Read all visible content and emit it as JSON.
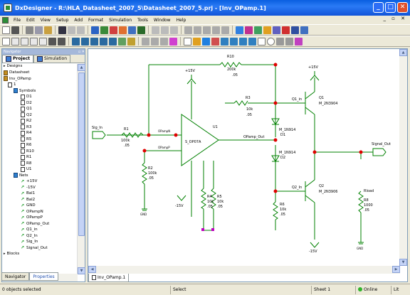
{
  "window": {
    "title": "DxDesigner - R:\\HLA_Datasheet_2007_5\\Datasheet_2007_5.prj - [Inv_OPamp.1]"
  },
  "menu": [
    "File",
    "Edit",
    "View",
    "Setup",
    "Add",
    "Format",
    "Simulation",
    "Tools",
    "Window",
    "Help"
  ],
  "panel": {
    "caption": "Navigator",
    "tabs": [
      "Project",
      "Simulation"
    ],
    "tree": [
      {
        "label": "Designs",
        "icon": "expand",
        "depth": 0
      },
      {
        "label": "Datasheet",
        "icon": "chip",
        "depth": 0
      },
      {
        "label": "Inv_OPamp",
        "icon": "chip",
        "depth": 1
      },
      {
        "label": "1",
        "icon": "sym",
        "depth": 2
      },
      {
        "label": "Symbols",
        "icon": "folder",
        "depth": 3
      },
      {
        "label": "D1",
        "icon": "sym",
        "depth": 4
      },
      {
        "label": "D2",
        "icon": "sym",
        "depth": 4
      },
      {
        "label": "Q1",
        "icon": "sym",
        "depth": 4
      },
      {
        "label": "Q2",
        "icon": "sym",
        "depth": 4
      },
      {
        "label": "R2",
        "icon": "sym",
        "depth": 4
      },
      {
        "label": "R3",
        "icon": "sym",
        "depth": 4
      },
      {
        "label": "R4",
        "icon": "sym",
        "depth": 4
      },
      {
        "label": "R5",
        "icon": "sym",
        "depth": 4
      },
      {
        "label": "R6",
        "icon": "sym",
        "depth": 4
      },
      {
        "label": "R10",
        "icon": "sym",
        "depth": 4
      },
      {
        "label": "R1",
        "icon": "sym",
        "depth": 4
      },
      {
        "label": "R8",
        "icon": "sym",
        "depth": 4
      },
      {
        "label": "U1",
        "icon": "sym",
        "depth": 4
      },
      {
        "label": "Nets",
        "icon": "folder",
        "depth": 3
      },
      {
        "label": "+15V",
        "icon": "net",
        "depth": 4
      },
      {
        "label": "-15V",
        "icon": "net",
        "depth": 4
      },
      {
        "label": "Bal1",
        "icon": "net",
        "depth": 4
      },
      {
        "label": "Bal2",
        "icon": "net",
        "depth": 4
      },
      {
        "label": "GND",
        "icon": "net",
        "depth": 4
      },
      {
        "label": "OPampN",
        "icon": "net",
        "depth": 4
      },
      {
        "label": "OPampP",
        "icon": "net",
        "depth": 4
      },
      {
        "label": "OPamp_Out",
        "icon": "net",
        "depth": 4
      },
      {
        "label": "Q1_in",
        "icon": "net",
        "depth": 4
      },
      {
        "label": "Q2_In",
        "icon": "net",
        "depth": 4
      },
      {
        "label": "Sig_In",
        "icon": "net",
        "depth": 4
      },
      {
        "label": "Signal_Out",
        "icon": "net",
        "depth": 4
      },
      {
        "label": "Blocks",
        "icon": "expand",
        "depth": 0
      }
    ],
    "bottom_tabs": [
      "Navigator",
      "Properties"
    ]
  },
  "schematic": {
    "tab": "Inv_OPamp.1",
    "sig_in": "Sig_In",
    "signal_out": "Signal_Out",
    "opamp": {
      "ref": "U1",
      "part": "S_OP07A",
      "inv": "OPampN",
      "noninv": "OPampP",
      "out": "OPamp_Out"
    },
    "r10": {
      "ref": "R10",
      "value": "200k",
      "tol": ".05"
    },
    "r1": {
      "ref": "R1",
      "value": "100k",
      "tol": ".05"
    },
    "r2": {
      "ref": "R2",
      "value": "100k",
      "tol": ".05"
    },
    "r3": {
      "ref": "R3",
      "value": "10k",
      "tol": ".05"
    },
    "r4": {
      "ref": "R4",
      "value": "10k",
      "tol": ".05"
    },
    "r5": {
      "ref": "R5",
      "value": "10k",
      "tol": ".05"
    },
    "r6": {
      "ref": "R6",
      "value": "10k",
      "tol": ".05"
    },
    "r8": {
      "ref": "R8",
      "value": "1000",
      "tol": ".05"
    },
    "d1": {
      "ref": "D1",
      "part": "M_1N914"
    },
    "d2": {
      "ref": "D2",
      "part": "M_1N914"
    },
    "q1": {
      "ref": "Q1",
      "part": "M_2N3904",
      "net": "Q1_in"
    },
    "q2": {
      "ref": "Q2",
      "part": "M_2N3906",
      "net": "Q2_In"
    },
    "rload": "Rload",
    "vpos": "+15V",
    "vneg": "-15V",
    "gnd": "GND"
  },
  "status": {
    "left": "0 objects selected",
    "mode": "Select",
    "sheet": "Sheet 1",
    "online": "Online",
    "right": "Lit"
  },
  "colors": {
    "wire": "#008000",
    "component": "#008000",
    "label": "#000000",
    "junction": "#e00000",
    "selection": "#c000c0"
  }
}
